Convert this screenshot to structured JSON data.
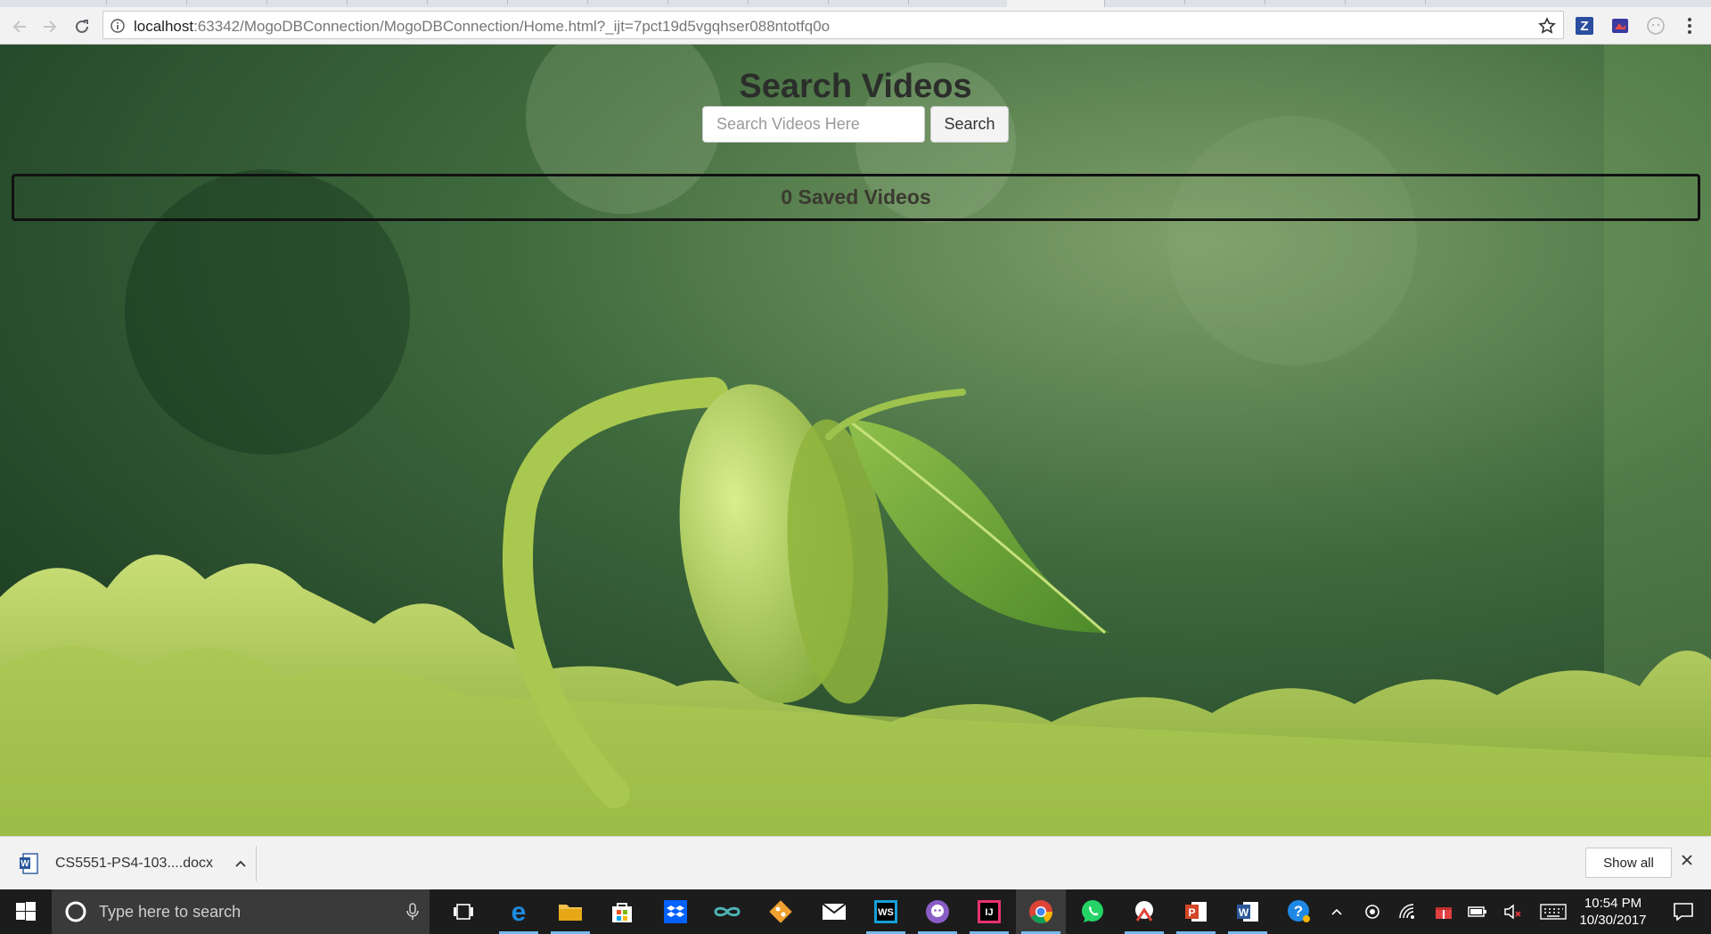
{
  "browser": {
    "url_host": "localhost",
    "url_rest": ":63342/MogoDBConnection/MogoDBConnection/Home.html?_ijt=7pct19d5vgqhser088ntotfq0o"
  },
  "page": {
    "title": "Search Videos",
    "search_placeholder": "Search Videos Here",
    "search_button": "Search",
    "saved_videos": "0 Saved Videos"
  },
  "download_shelf": {
    "file_name": "CS5551-PS4-103....docx",
    "show_all": "Show all"
  },
  "taskbar": {
    "search_placeholder": "Type here to search",
    "time": "10:54 PM",
    "date": "10/30/2017",
    "apps": [
      "task-view",
      "edge",
      "file-explorer",
      "store",
      "dropbox",
      "arduino",
      "git",
      "mail",
      "webstorm",
      "github",
      "intellij",
      "chrome",
      "whatsapp",
      "snipping-tool",
      "powerpoint",
      "word",
      "help"
    ]
  },
  "colors": {
    "accent": "#76b9ed",
    "page_title": "#2b2e2b",
    "panel_border": "#111111"
  }
}
